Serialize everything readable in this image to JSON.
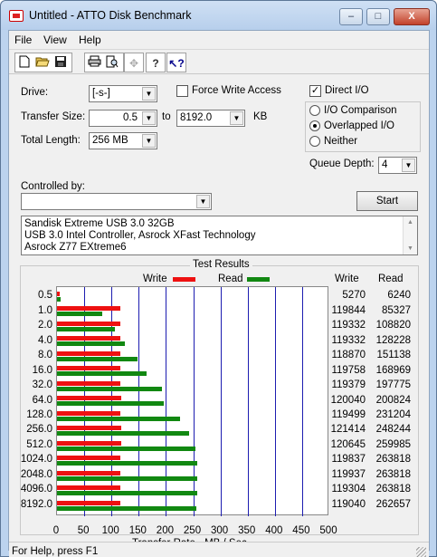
{
  "window": {
    "title": "Untitled - ATTO Disk Benchmark",
    "controls": {
      "minimize": "–",
      "maximize": "□",
      "close": "X"
    }
  },
  "menu": [
    "File",
    "View",
    "Help"
  ],
  "toolbar": {
    "icons": [
      "new-document-icon",
      "open-folder-icon",
      "save-disk-icon",
      "print-icon",
      "print-preview-icon",
      "move-cross-icon",
      "help-question-icon",
      "context-help-icon"
    ]
  },
  "settings": {
    "drive_label": "Drive:",
    "drive_value": "[-s-]",
    "force_write_access_label": "Force Write Access",
    "force_write_access_checked": false,
    "direct_io_label": "Direct I/O",
    "direct_io_checked": true,
    "transfer_size_label": "Transfer Size:",
    "transfer_from": "0.5",
    "to_label": "to",
    "transfer_to": "8192.0",
    "kb_label": "KB",
    "total_length_label": "Total Length:",
    "total_length_value": "256 MB",
    "io_options": [
      {
        "label": "I/O Comparison",
        "selected": false
      },
      {
        "label": "Overlapped I/O",
        "selected": true
      },
      {
        "label": "Neither",
        "selected": false
      }
    ],
    "queue_depth_label": "Queue Depth:",
    "queue_depth_value": "4",
    "controlled_by_label": "Controlled by:",
    "controlled_by_value": "",
    "start_label": "Start"
  },
  "description_lines": [
    "Sandisk Extreme USB 3.0 32GB",
    "USB 3.0 Intel Controller, Asrock XFast Technology",
    "Asrock Z77 EXtreme6"
  ],
  "results": {
    "title": "Test Results",
    "legend_write": "Write",
    "legend_read": "Read",
    "col_write": "Write",
    "col_read": "Read",
    "xlabel": "Transfer Rate - MB / Sec",
    "colors": {
      "write": "#ee1111",
      "read": "#118811",
      "grid": "#1c1cb0"
    }
  },
  "chart_data": {
    "type": "bar",
    "title": "Test Results",
    "xlabel": "Transfer Rate - MB / Sec",
    "ylabel": "",
    "xlim": [
      0,
      500
    ],
    "x_ticks": [
      "0",
      "50",
      "100",
      "150",
      "200",
      "250",
      "300",
      "350",
      "400",
      "450",
      "500"
    ],
    "categories": [
      "0.5",
      "1.0",
      "2.0",
      "4.0",
      "8.0",
      "16.0",
      "32.0",
      "64.0",
      "128.0",
      "256.0",
      "512.0",
      "1024.0",
      "2048.0",
      "4096.0",
      "8192.0"
    ],
    "series": [
      {
        "name": "Write",
        "values_kbps": [
          "5270",
          "119844",
          "119332",
          "119332",
          "118870",
          "119758",
          "119379",
          "120040",
          "119499",
          "121414",
          "120645",
          "119837",
          "119937",
          "119304",
          "119040"
        ],
        "mbps": [
          5.1,
          117.0,
          116.5,
          116.5,
          116.1,
          117.0,
          116.6,
          117.2,
          116.7,
          118.6,
          117.8,
          117.0,
          117.1,
          116.5,
          116.3
        ]
      },
      {
        "name": "Read",
        "values_kbps": [
          "6240",
          "85327",
          "108820",
          "128228",
          "151138",
          "168969",
          "197775",
          "200824",
          "231204",
          "248244",
          "259985",
          "263818",
          "263818",
          "263818",
          "262657"
        ],
        "mbps": [
          6.1,
          83.3,
          106.3,
          125.2,
          147.6,
          165.0,
          193.1,
          196.1,
          225.8,
          242.4,
          253.9,
          257.6,
          257.6,
          257.6,
          256.5
        ]
      }
    ]
  },
  "status": {
    "text": "For Help, press F1"
  }
}
